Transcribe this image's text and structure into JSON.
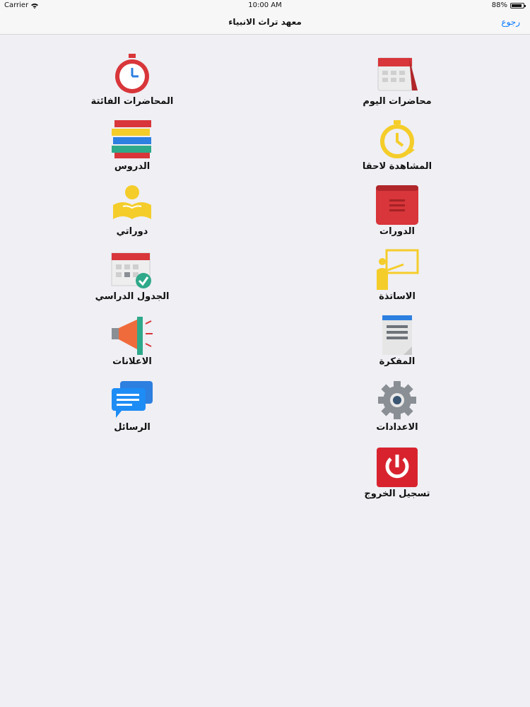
{
  "status_bar": {
    "carrier": "Carrier",
    "time": "10:00 AM",
    "battery": "88%",
    "battery_level": 0.88
  },
  "nav": {
    "title": "معهد تراث الانبياء",
    "back_label": "رجوع"
  },
  "menu": {
    "todays_lectures": "محاضرات اليوم",
    "missed_lectures": "المحاضرات الفائتة",
    "watch_later": "المشاهدة لاحقا",
    "lessons": "الدروس",
    "courses": "الدورات",
    "my_courses": "دوراتي",
    "teachers": "الاساتذة",
    "schedule": "الجدول الدراسي",
    "notebook": "المفكرة",
    "announcements": "الاعلانات",
    "settings": "الاعدادات",
    "messages": "الرسائل",
    "logout": "تسجيل الخروج"
  },
  "colors": {
    "accent": "#0a7aff",
    "red": "#d8363a",
    "yellow": "#f5cd2a",
    "gray": "#8a8f95"
  }
}
